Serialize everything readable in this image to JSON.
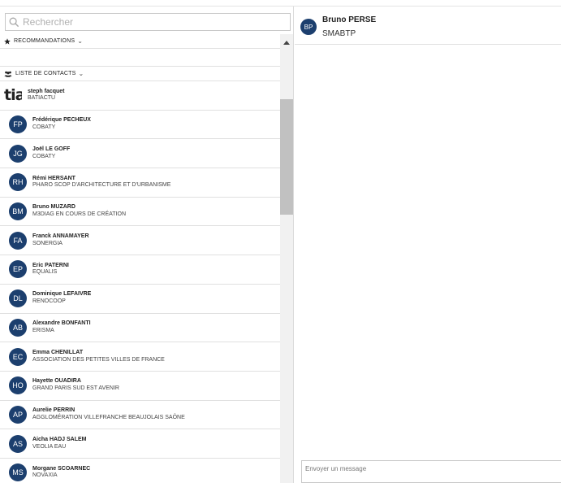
{
  "search": {
    "placeholder": "Rechercher",
    "icon": "search-icon"
  },
  "sections": {
    "recommendations": {
      "label": "RECOMMANDATIONS",
      "icon": "star-icon"
    },
    "contacts": {
      "label": "LISTE DE CONTACTS",
      "icon": "users-icon"
    }
  },
  "contacts": [
    {
      "initials": "tia",
      "name": "steph facquet",
      "org": "BATIACTU",
      "logo": true
    },
    {
      "initials": "FP",
      "name": "Frédérique PECHEUX",
      "org": "COBATY"
    },
    {
      "initials": "JG",
      "name": "Joël LE GOFF",
      "org": "COBATY"
    },
    {
      "initials": "RH",
      "name": "Rémi HERSANT",
      "org": "PHARO SCOP D'ARCHITECTURE ET D'URBANISME"
    },
    {
      "initials": "BM",
      "name": "Bruno MUZARD",
      "org": "M3DIAG EN COURS DE CRÉATION"
    },
    {
      "initials": "FA",
      "name": "Franck ANNAMAYER",
      "org": "SONERGIA"
    },
    {
      "initials": "EP",
      "name": "Eric PATERNI",
      "org": "EQUALIS"
    },
    {
      "initials": "DL",
      "name": "Dominique LEFAIVRE",
      "org": "RENOCOOP"
    },
    {
      "initials": "AB",
      "name": "Alexandre BONFANTI",
      "org": "ERISMA"
    },
    {
      "initials": "EC",
      "name": "Emma CHENILLAT",
      "org": "ASSOCIATION DES PETITES VILLES DE FRANCE"
    },
    {
      "initials": "HO",
      "name": "Hayette OUADIRA",
      "org": "GRAND PARIS SUD EST AVENIR"
    },
    {
      "initials": "AP",
      "name": "Aurelie PERRIN",
      "org": "AGGLOMÉRATION VILLEFRANCHE BEAUJOLAIS SAÔNE"
    },
    {
      "initials": "AS",
      "name": "Aicha HADJ SALEM",
      "org": "VEOLIA EAU"
    },
    {
      "initials": "MS",
      "name": "Morgane SCOARNEC",
      "org": "NOVAXIA"
    }
  ],
  "chat": {
    "avatar_initials": "BP",
    "name": "Bruno PERSE",
    "org": "SMABTP",
    "message_placeholder": "Envoyer un message"
  },
  "colors": {
    "avatar_bg": "#1c3f6e",
    "scroll_thumb": "#c1c1c1"
  }
}
